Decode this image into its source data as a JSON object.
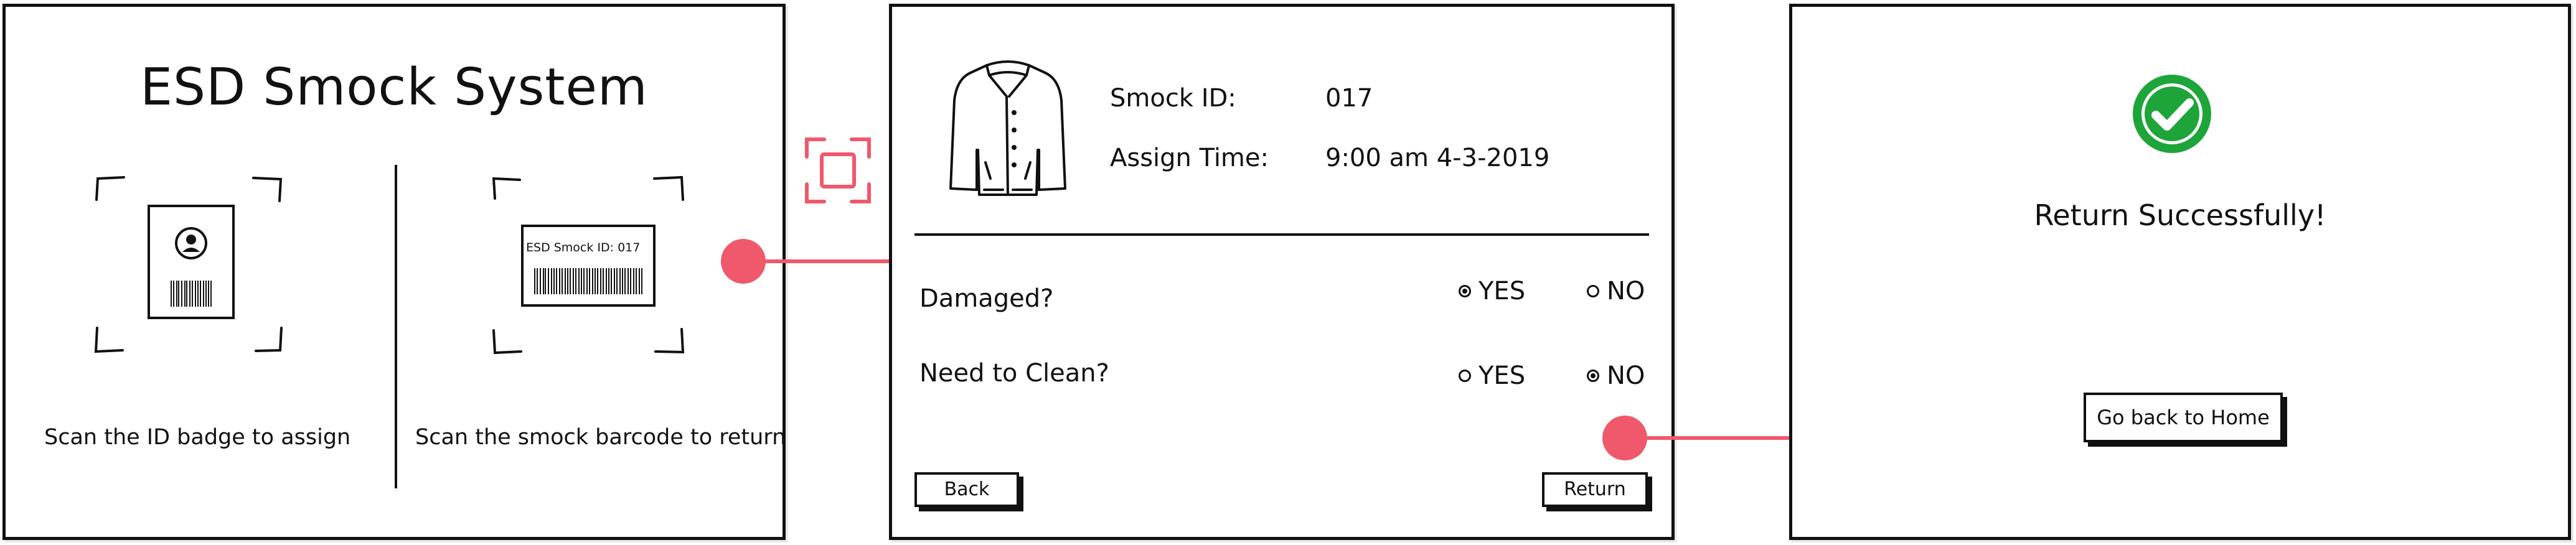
{
  "screen1": {
    "title": "ESD Smock System",
    "badge_caption": "Scan the ID badge to assign",
    "barcode_caption": "Scan the smock barcode to return",
    "barcode_card_label": "ESD Smock ID: 017"
  },
  "screen2": {
    "smock_id_label": "Smock ID:",
    "smock_id_value": "017",
    "assign_time_label": "Assign Time:",
    "assign_time_value": "9:00 am 4-3-2019",
    "questions": [
      {
        "label": "Damaged?",
        "yes": "YES",
        "no": "NO",
        "selected": "YES"
      },
      {
        "label": "Need to Clean?",
        "yes": "YES",
        "no": "NO",
        "selected": "NO"
      }
    ],
    "back_button": "Back",
    "return_button": "Return"
  },
  "screen3": {
    "message": "Return Successfully!",
    "home_button": "Go back to Home"
  },
  "colors": {
    "accent": "#f0586b",
    "success": "#1ea53a",
    "ink": "#111111"
  }
}
